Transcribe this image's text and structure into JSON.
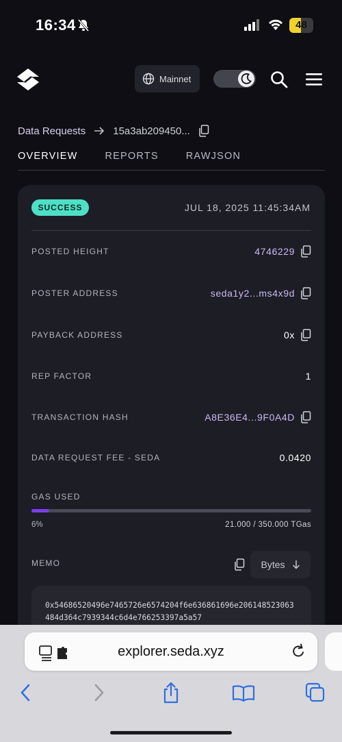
{
  "status_bar": {
    "time": "16:34",
    "battery": "48",
    "battery_level": 0.48
  },
  "header": {
    "network_label": "Mainnet"
  },
  "breadcrumb": {
    "parent": "Data Requests",
    "current": "15a3ab209450..."
  },
  "tabs": [
    {
      "label": "OVERVIEW",
      "active": true
    },
    {
      "label": "REPORTS",
      "active": false
    },
    {
      "label": "RAWJSON",
      "active": false
    }
  ],
  "card": {
    "status": "SUCCESS",
    "date": "JUL 18, 2025 11:45:34AM",
    "rows": [
      {
        "label": "POSTED HEIGHT",
        "value": "4746229",
        "copyable": true,
        "style": "purple"
      },
      {
        "label": "POSTER ADDRESS",
        "value": "seda1y2...ms4x9d",
        "copyable": true,
        "style": "purple"
      },
      {
        "label": "PAYBACK ADDRESS",
        "value": "0x",
        "copyable": true,
        "style": "white"
      },
      {
        "label": "REP FACTOR",
        "value": "1",
        "copyable": false,
        "style": "white"
      },
      {
        "label": "TRANSACTION HASH",
        "value": "A8E36E4...9F0A4D",
        "copyable": true,
        "style": "purple"
      },
      {
        "label": "DATA REQUEST FEE - SEDA",
        "value": "0.0420",
        "copyable": false,
        "style": "white"
      }
    ],
    "gas": {
      "label": "GAS USED",
      "percent_text": "6%",
      "percent": 6,
      "amount": "21.000 / 350.000 TGas"
    },
    "memo": {
      "label": "MEMO",
      "format_label": "Bytes",
      "value": "0x54686520496e7465726e6574204f6e636861696e206148523063484d364c7939344c6d4e766253397a5a57"
    }
  },
  "browser": {
    "url": "explorer.seda.xyz"
  },
  "colors": {
    "accent": "#7b3cf0",
    "success": "#4ee0c6",
    "value_purple": "#cdb8f5",
    "card_bg": "#1d1d25",
    "page_bg": "#0e0e14"
  }
}
